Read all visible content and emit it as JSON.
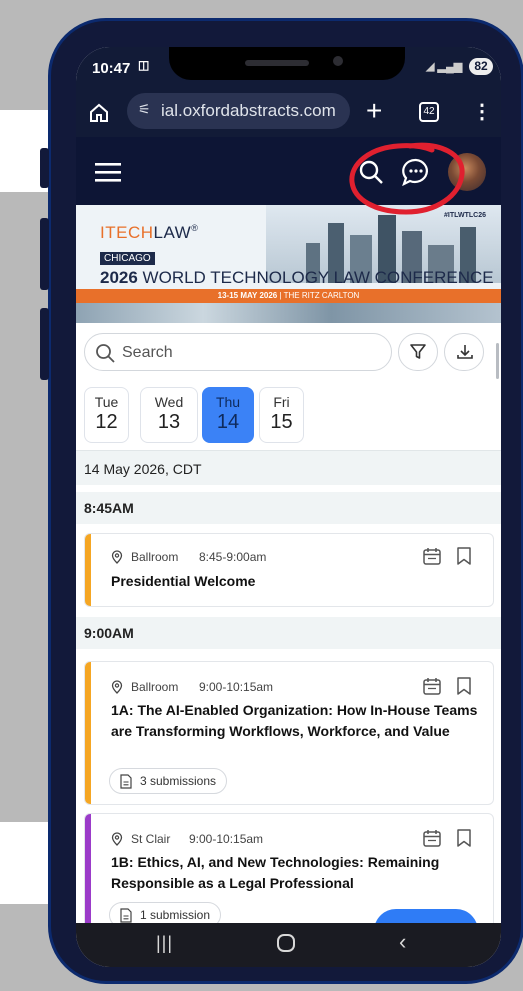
{
  "status": {
    "time": "10:47",
    "battery": "82"
  },
  "browser": {
    "url": "ial.oxfordabstracts.com",
    "tab_count": "42"
  },
  "banner": {
    "logo_prefix": "ITECH",
    "logo_suffix": "LAW",
    "city": "CHICAGO",
    "year": "2026",
    "conference": " WORLD TECHNOLOGY LAW CONFERENCE",
    "dates": "13-15 MAY 2026",
    "venue": " | THE RITZ CARLTON",
    "hashtag": "#ITLWTLC26"
  },
  "search": {
    "placeholder": "Search"
  },
  "days": [
    {
      "dow": "Tue",
      "num": "12"
    },
    {
      "dow": "Wed",
      "num": "13"
    },
    {
      "dow": "Thu",
      "num": "14"
    },
    {
      "dow": "Fri",
      "num": "15"
    }
  ],
  "date_header": "14 May 2026, CDT",
  "sessions": [
    {
      "time_header": "8:45AM",
      "location": "Ballroom",
      "time": "8:45-9:00am",
      "title": "Presidential Welcome",
      "accent": "#f5a623"
    },
    {
      "time_header": "9:00AM",
      "location": "Ballroom",
      "time": "9:00-10:15am",
      "title": "1A: The AI-Enabled Organization: How In-House Teams are Transforming Workflows, Workforce, and Value",
      "submissions": "3 submissions",
      "accent": "#f5a623"
    },
    {
      "location": "St Clair",
      "time": "9:00-10:15am",
      "title": "1B: Ethics, AI, and New Technologies: Remaining Responsible as a Legal Professional",
      "submissions": "1 submission",
      "accent": "#9b3bc9"
    }
  ],
  "colors": {
    "annotation": "#e0202f",
    "selected_day": "#3b82f6",
    "appbar": "#0d1535"
  }
}
